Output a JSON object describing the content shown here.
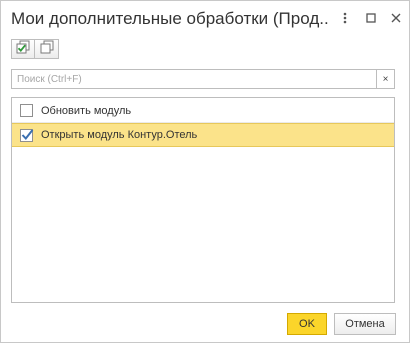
{
  "window": {
    "title": "Мои дополнительные обработки (Прод...",
    "more_icon": "more-vertical-icon",
    "maximize_icon": "maximize-icon",
    "close_icon": "close-icon"
  },
  "toolbar": {
    "buttons": [
      {
        "icon": "check-all-icon"
      },
      {
        "icon": "uncheck-all-icon"
      }
    ]
  },
  "search": {
    "placeholder": "Поиск (Ctrl+F)",
    "value": "",
    "clear_label": "×"
  },
  "list": {
    "items": [
      {
        "label": "Обновить модуль",
        "checked": false,
        "selected": false
      },
      {
        "label": "Открыть модуль Контур.Отель",
        "checked": true,
        "selected": true
      }
    ]
  },
  "footer": {
    "ok_label": "OK",
    "cancel_label": "Отмена"
  },
  "colors": {
    "accent": "#fbd52a",
    "selection": "#fbe38a",
    "check": "#3a6fb0"
  }
}
